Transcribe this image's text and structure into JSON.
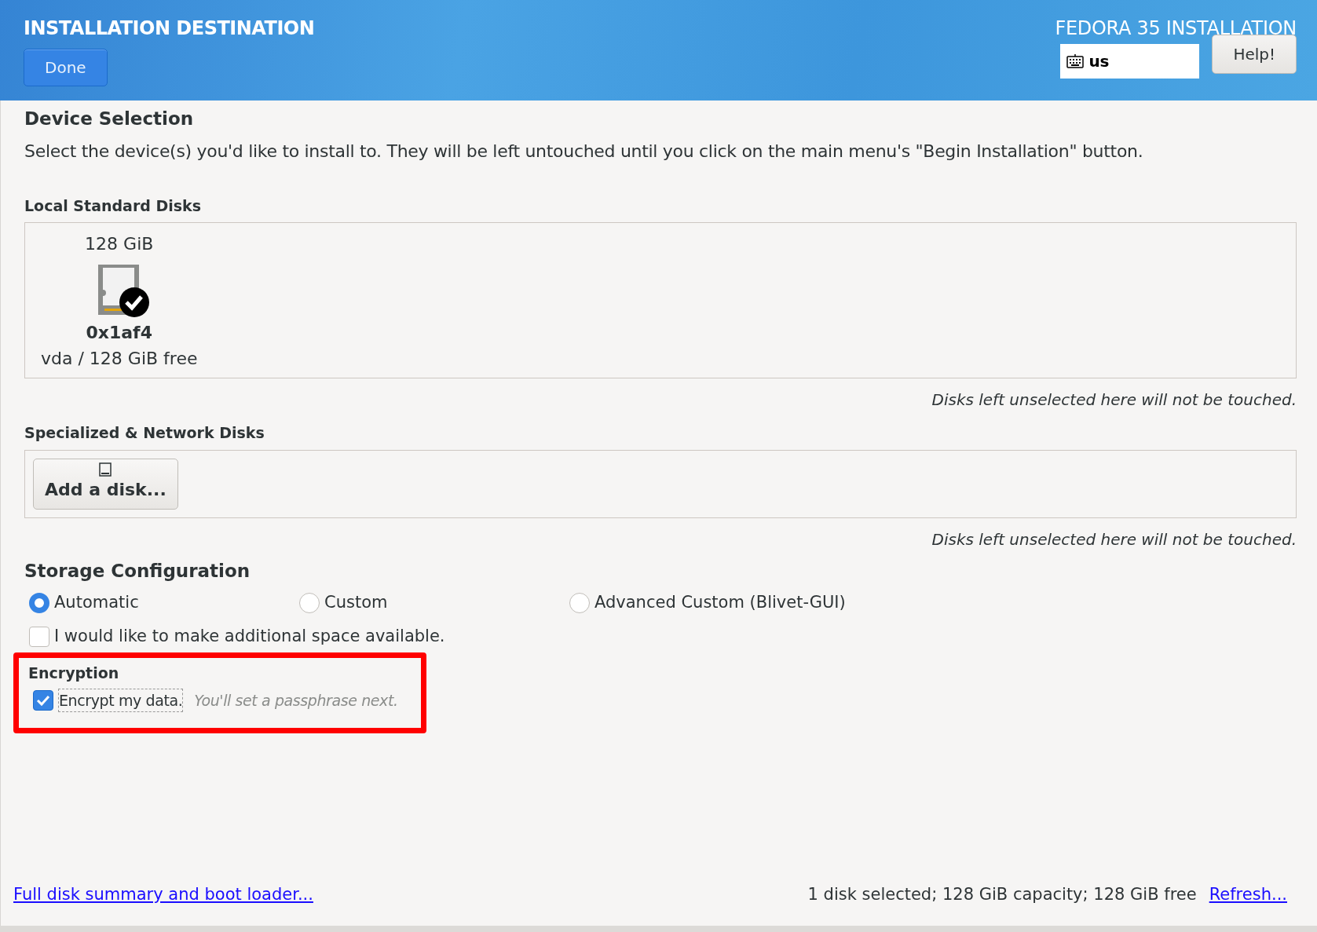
{
  "header": {
    "title": "INSTALLATION DESTINATION",
    "done_button": "Done",
    "product": "FEDORA 35 INSTALLATION",
    "keyboard_layout": "us",
    "help_button": "Help!"
  },
  "device_selection": {
    "heading": "Device Selection",
    "description": "Select the device(s) you'd like to install to.  They will be left untouched until you click on the main menu's \"Begin Installation\" button."
  },
  "local_disks": {
    "heading": "Local Standard Disks",
    "disks": [
      {
        "size": "128 GiB",
        "name": "0x1af4",
        "detail": "vda / 128 GiB free",
        "selected": true
      }
    ],
    "note": "Disks left unselected here will not be touched."
  },
  "network_disks": {
    "heading": "Specialized & Network Disks",
    "add_button": "Add a disk...",
    "note": "Disks left unselected here will not be touched."
  },
  "storage": {
    "heading": "Storage Configuration",
    "options": [
      {
        "label": "Automatic",
        "selected": true
      },
      {
        "label": "Custom",
        "selected": false
      },
      {
        "label": "Advanced Custom (Blivet-GUI)",
        "selected": false
      }
    ],
    "reclaim": {
      "label": "I would like to make additional space available.",
      "checked": false
    }
  },
  "encryption": {
    "heading": "Encryption",
    "label": "Encrypt my data.",
    "checked": true,
    "hint": "You'll set a passphrase next.",
    "highlighted": true
  },
  "footer": {
    "summary_link": "Full disk summary and boot loader...",
    "status": "1 disk selected; 128 GiB capacity; 128 GiB free",
    "refresh_link": "Refresh..."
  }
}
